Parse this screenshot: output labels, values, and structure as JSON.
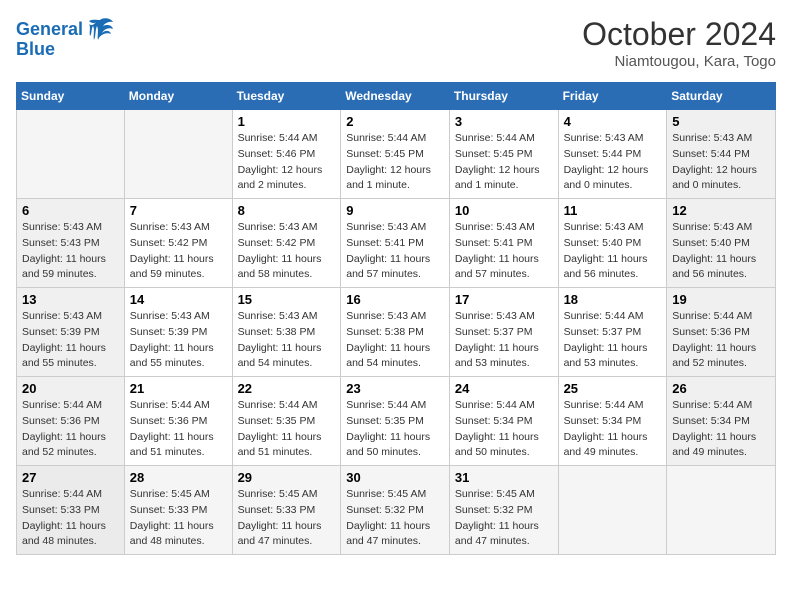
{
  "header": {
    "logo_line1": "General",
    "logo_line2": "Blue",
    "month": "October 2024",
    "location": "Niamtougou, Kara, Togo"
  },
  "days_of_week": [
    "Sunday",
    "Monday",
    "Tuesday",
    "Wednesday",
    "Thursday",
    "Friday",
    "Saturday"
  ],
  "weeks": [
    [
      {
        "day": "",
        "info": ""
      },
      {
        "day": "",
        "info": ""
      },
      {
        "day": "1",
        "info": "Sunrise: 5:44 AM\nSunset: 5:46 PM\nDaylight: 12 hours\nand 2 minutes."
      },
      {
        "day": "2",
        "info": "Sunrise: 5:44 AM\nSunset: 5:45 PM\nDaylight: 12 hours\nand 1 minute."
      },
      {
        "day": "3",
        "info": "Sunrise: 5:44 AM\nSunset: 5:45 PM\nDaylight: 12 hours\nand 1 minute."
      },
      {
        "day": "4",
        "info": "Sunrise: 5:43 AM\nSunset: 5:44 PM\nDaylight: 12 hours\nand 0 minutes."
      },
      {
        "day": "5",
        "info": "Sunrise: 5:43 AM\nSunset: 5:44 PM\nDaylight: 12 hours\nand 0 minutes."
      }
    ],
    [
      {
        "day": "6",
        "info": "Sunrise: 5:43 AM\nSunset: 5:43 PM\nDaylight: 11 hours\nand 59 minutes."
      },
      {
        "day": "7",
        "info": "Sunrise: 5:43 AM\nSunset: 5:42 PM\nDaylight: 11 hours\nand 59 minutes."
      },
      {
        "day": "8",
        "info": "Sunrise: 5:43 AM\nSunset: 5:42 PM\nDaylight: 11 hours\nand 58 minutes."
      },
      {
        "day": "9",
        "info": "Sunrise: 5:43 AM\nSunset: 5:41 PM\nDaylight: 11 hours\nand 57 minutes."
      },
      {
        "day": "10",
        "info": "Sunrise: 5:43 AM\nSunset: 5:41 PM\nDaylight: 11 hours\nand 57 minutes."
      },
      {
        "day": "11",
        "info": "Sunrise: 5:43 AM\nSunset: 5:40 PM\nDaylight: 11 hours\nand 56 minutes."
      },
      {
        "day": "12",
        "info": "Sunrise: 5:43 AM\nSunset: 5:40 PM\nDaylight: 11 hours\nand 56 minutes."
      }
    ],
    [
      {
        "day": "13",
        "info": "Sunrise: 5:43 AM\nSunset: 5:39 PM\nDaylight: 11 hours\nand 55 minutes."
      },
      {
        "day": "14",
        "info": "Sunrise: 5:43 AM\nSunset: 5:39 PM\nDaylight: 11 hours\nand 55 minutes."
      },
      {
        "day": "15",
        "info": "Sunrise: 5:43 AM\nSunset: 5:38 PM\nDaylight: 11 hours\nand 54 minutes."
      },
      {
        "day": "16",
        "info": "Sunrise: 5:43 AM\nSunset: 5:38 PM\nDaylight: 11 hours\nand 54 minutes."
      },
      {
        "day": "17",
        "info": "Sunrise: 5:43 AM\nSunset: 5:37 PM\nDaylight: 11 hours\nand 53 minutes."
      },
      {
        "day": "18",
        "info": "Sunrise: 5:44 AM\nSunset: 5:37 PM\nDaylight: 11 hours\nand 53 minutes."
      },
      {
        "day": "19",
        "info": "Sunrise: 5:44 AM\nSunset: 5:36 PM\nDaylight: 11 hours\nand 52 minutes."
      }
    ],
    [
      {
        "day": "20",
        "info": "Sunrise: 5:44 AM\nSunset: 5:36 PM\nDaylight: 11 hours\nand 52 minutes."
      },
      {
        "day": "21",
        "info": "Sunrise: 5:44 AM\nSunset: 5:36 PM\nDaylight: 11 hours\nand 51 minutes."
      },
      {
        "day": "22",
        "info": "Sunrise: 5:44 AM\nSunset: 5:35 PM\nDaylight: 11 hours\nand 51 minutes."
      },
      {
        "day": "23",
        "info": "Sunrise: 5:44 AM\nSunset: 5:35 PM\nDaylight: 11 hours\nand 50 minutes."
      },
      {
        "day": "24",
        "info": "Sunrise: 5:44 AM\nSunset: 5:34 PM\nDaylight: 11 hours\nand 50 minutes."
      },
      {
        "day": "25",
        "info": "Sunrise: 5:44 AM\nSunset: 5:34 PM\nDaylight: 11 hours\nand 49 minutes."
      },
      {
        "day": "26",
        "info": "Sunrise: 5:44 AM\nSunset: 5:34 PM\nDaylight: 11 hours\nand 49 minutes."
      }
    ],
    [
      {
        "day": "27",
        "info": "Sunrise: 5:44 AM\nSunset: 5:33 PM\nDaylight: 11 hours\nand 48 minutes."
      },
      {
        "day": "28",
        "info": "Sunrise: 5:45 AM\nSunset: 5:33 PM\nDaylight: 11 hours\nand 48 minutes."
      },
      {
        "day": "29",
        "info": "Sunrise: 5:45 AM\nSunset: 5:33 PM\nDaylight: 11 hours\nand 47 minutes."
      },
      {
        "day": "30",
        "info": "Sunrise: 5:45 AM\nSunset: 5:32 PM\nDaylight: 11 hours\nand 47 minutes."
      },
      {
        "day": "31",
        "info": "Sunrise: 5:45 AM\nSunset: 5:32 PM\nDaylight: 11 hours\nand 47 minutes."
      },
      {
        "day": "",
        "info": ""
      },
      {
        "day": "",
        "info": ""
      }
    ]
  ]
}
